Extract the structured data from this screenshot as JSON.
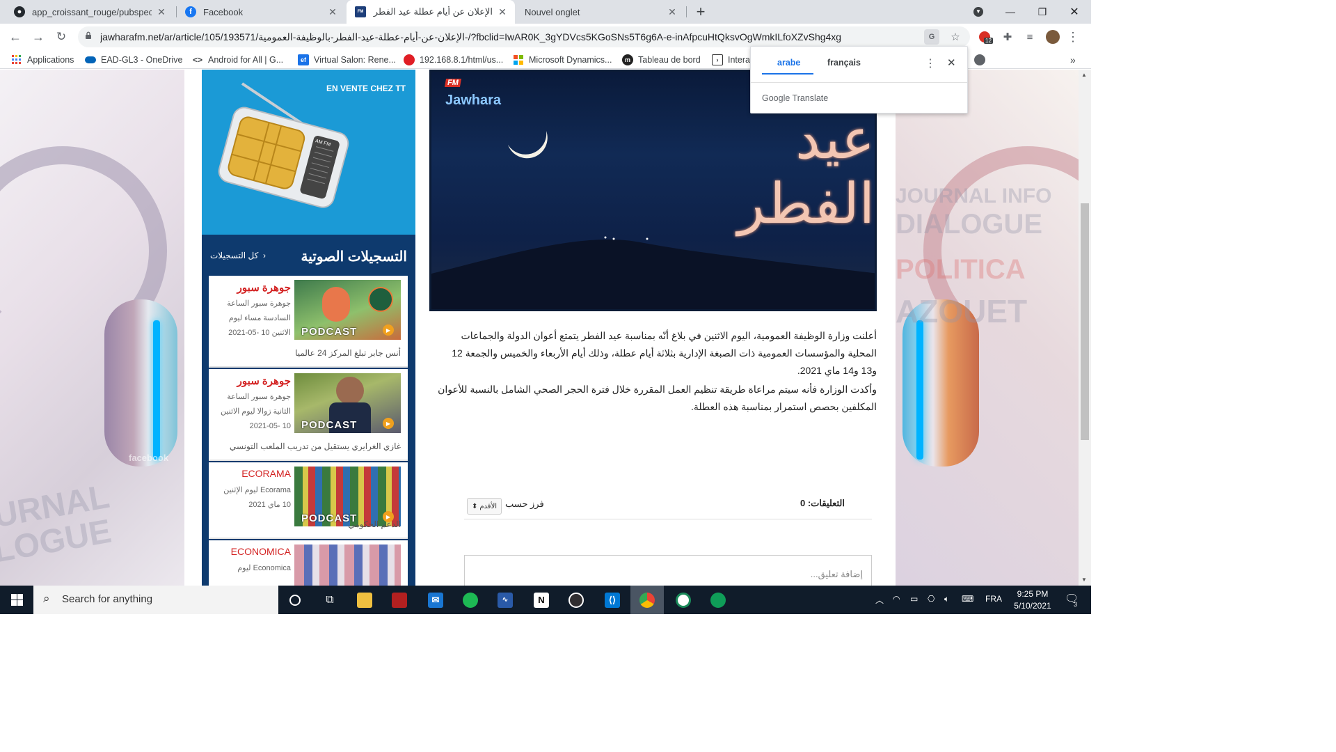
{
  "tabs": [
    {
      "title": "app_croissant_rouge/pubspec.ya",
      "favicon": "github-icon"
    },
    {
      "title": "Facebook",
      "favicon": "facebook-icon"
    },
    {
      "title": "الإعلان عن أيام عطلة عيد الفطر بال",
      "favicon": "jawhara-icon"
    },
    {
      "title": "Nouvel onglet",
      "favicon": "none"
    }
  ],
  "url": "jawharafm.net/ar/article/105/193571/الإعلان-عن-أيام-عطلة-عيد-الفطر-بالوظيفة-العمومية-/?fbclid=IwAR0K_3gYDVcs5KGoSNs5T6g6A-e-inAfpcuHtQksvOgWmkILfoXZvShg4xg",
  "extension_badge": "12",
  "bookmarks": [
    "Applications",
    "EAD-GL3 - OneDrive",
    "Android for All | G...",
    "Virtual Salon: Rene...",
    "192.168.8.1/html/us...",
    "Microsoft Dynamics...",
    "Tableau de bord",
    "Intera"
  ],
  "translate": {
    "lang_active": "arabe",
    "lang_other": "français",
    "brand": "Google Translate"
  },
  "ad": {
    "text": "EN VENTE CHEZ TT",
    "radio_bands": "AM FM"
  },
  "recordings": {
    "title": "التسجيلات الصوتية",
    "all_link": "كل التسجيلات",
    "podcast_label": "PODCAST",
    "cards": [
      {
        "title": "جوهرة سبور",
        "desc": "جوهرة سبور الساعة السادسة مساء ليوم الاثنين 10 -05-2021",
        "footer": "أنس جابر تبلغ المركز 24 عالميا"
      },
      {
        "title": "جوهرة سبور",
        "desc": "جوهرة سبور الساعة الثانية زوالا ليوم الاثنين 10 -05-2021",
        "footer": "غازي الغرايري يستقيل من تدريب الملعب التونسي"
      },
      {
        "title": "ECORAMA",
        "desc": "Ecorama ليوم الإثنين 10 ماي 2021",
        "footer": "الدعم الحكومي"
      },
      {
        "title": "ECONOMICA",
        "desc": "Economica ليوم",
        "footer": ""
      }
    ]
  },
  "hero": {
    "brand": "Jawhara",
    "brand_badge": "FM",
    "calligraphy": "عيد الفطر"
  },
  "article": {
    "p1": "أعلنت وزارة الوظيفة العمومية، اليوم الاثنين في بلاغ  أنّه بمناسبة عيد الفطر  يتمتع أعوان الدولة والجماعات المحلية والمؤسسات العمومية ذات الصبغة الإدارية بثلاثة أيام عطلة، وذلك أيام الأربعاء والخميس والجمعة 12 و13 و14 ماي 2021.",
    "p2": "وأكدت الوزارة فأنه سيتم مراعاة طريقة تنظيم العمل المقررة خلال فترة الحجر الصحي الشامل بالنسبة للأعوان المكلفين بحصص استمرار بمناسبة هذه العطلة."
  },
  "comments": {
    "label": "التعليقات: 0",
    "sort_label": "فرز حسب",
    "sort_value": "الأقدم",
    "placeholder": "إضافة تعليق..."
  },
  "taskbar": {
    "search_placeholder": "Search for anything",
    "language": "FRA",
    "time": "9:25 PM",
    "date": "5/10/2021",
    "notifications": "3"
  }
}
